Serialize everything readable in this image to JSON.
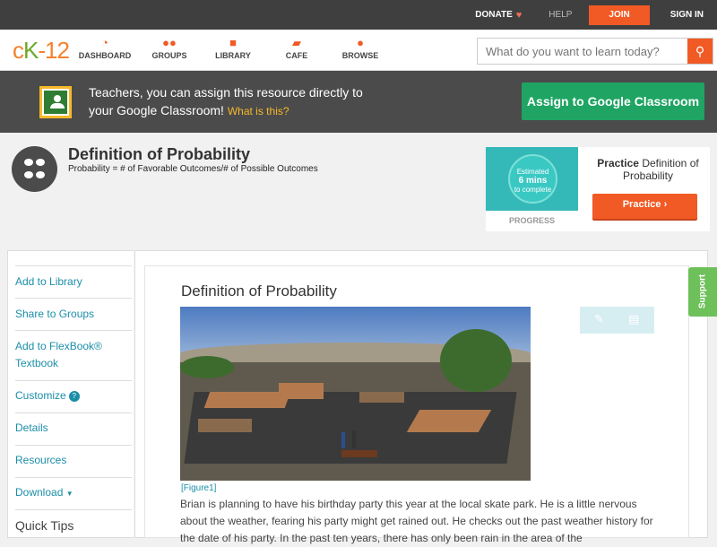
{
  "topbar": {
    "donate": "DONATE",
    "help": "HELP",
    "join": "JOIN",
    "signin": "SIGN IN"
  },
  "nav": {
    "logo_c": "c",
    "logo_k": "K",
    "logo_rest": "-12",
    "items": [
      {
        "label": "DASHBOARD",
        "icon": "speedometer-icon"
      },
      {
        "label": "GROUPS",
        "icon": "group-icon"
      },
      {
        "label": "LIBRARY",
        "icon": "book-icon"
      },
      {
        "label": "CAFE",
        "icon": "chat-icon"
      },
      {
        "label": "BROWSE",
        "icon": "lightbulb-icon"
      }
    ],
    "search_placeholder": "What do you want to learn today?"
  },
  "banner": {
    "line1": "Teachers, you can assign this resource directly to",
    "line2": "your Google Classroom!",
    "what": "What is this?",
    "assign_button": "Assign to Google Classroom"
  },
  "concept": {
    "title": "Definition of Probability",
    "subtitle": "Probability = # of Favorable Outcomes/# of Possible Outcomes"
  },
  "practice": {
    "est_1": "Estimated",
    "est_2": "6 mins",
    "est_3": "to complete",
    "progress_label": "PROGRESS",
    "title_bold": "Practice",
    "title_rest": "Definition of Probability",
    "button": "Practice"
  },
  "sidebar": {
    "items": [
      "Add to Library",
      "Share to Groups",
      "Add to FlexBook®",
      "Textbook",
      "Customize",
      "Details",
      "Resources",
      "Download"
    ],
    "quick_tips": "Quick Tips"
  },
  "main": {
    "title": "Definition of Probability",
    "caption": "[Figure1]",
    "paragraph": "Brian is planning to have his birthday party this year at the local skate park.  He is a little nervous about the weather, fearing his party might get rained out.  He checks out the past weather history for the date of his party.  In the past ten years, there has only been rain in the area of the"
  },
  "support": "Support",
  "colors": {
    "accent": "#f15a24",
    "green": "#1fa463",
    "teal": "#35b9b8",
    "link": "#1b8fa8"
  }
}
